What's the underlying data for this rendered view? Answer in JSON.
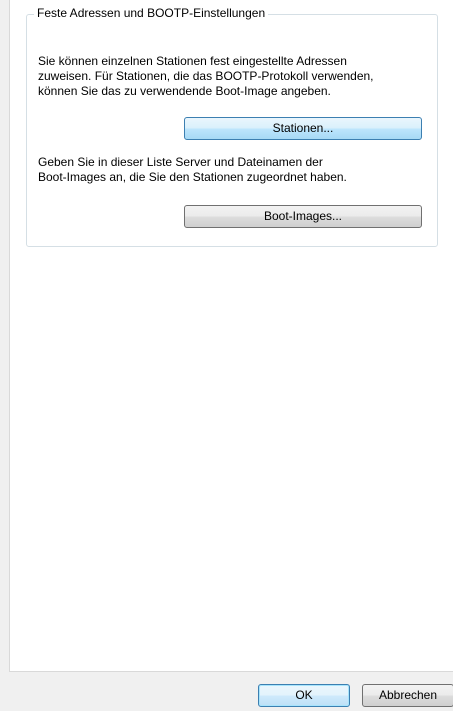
{
  "group": {
    "title": "Feste Adressen und BOOTP-Einstellungen",
    "stations_text_lines": [
      "Sie können einzelnen Stationen fest eingestellte Adressen",
      "zuweisen. Für Stationen, die das BOOTP-Protokoll verwenden,",
      "können Sie das zu verwendende Boot-Image angeben."
    ],
    "stations_button_label": "Stationen...",
    "bootimages_text_lines": [
      "Geben Sie in dieser Liste Server und Dateinamen der",
      "Boot-Images an, die Sie den Stationen zugeordnet haben."
    ],
    "bootimages_button_label": "Boot-Images..."
  },
  "footer": {
    "ok_label": "OK",
    "cancel_label": "Abbrechen"
  }
}
